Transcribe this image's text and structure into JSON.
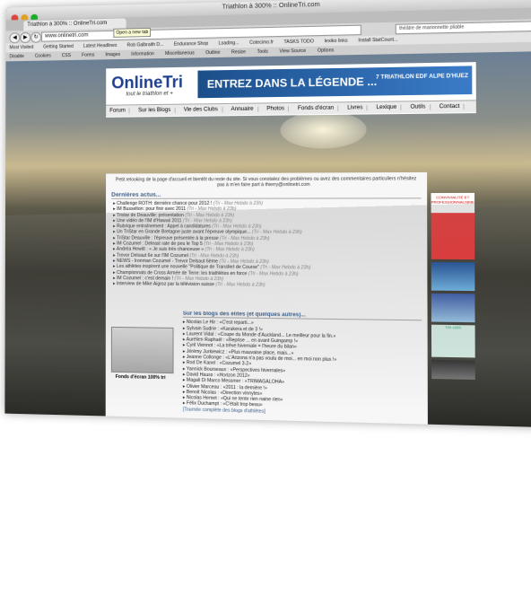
{
  "window": {
    "title": "Triathlon à 300% :: OnlineTri.com"
  },
  "tab": {
    "label": "Triathlon à 300% :: OnlineTri.com",
    "tooltip": "Open a new tab"
  },
  "navbar": {
    "url": "www.onlinetri.com",
    "search": "théâtre de marionnette pliable"
  },
  "bookmarks": [
    "Most Visited",
    "Getting Started",
    "Latest Headlines",
    "Rob Galbraith D...",
    "Endurance Shop",
    "Loading...",
    "Cotecimo.fr",
    "TASKS TODO",
    "lexiko links",
    "Install StatCount..."
  ],
  "toolbar": [
    "Disable",
    "Cookies",
    "CSS",
    "Forms",
    "Images",
    "Information",
    "Miscellaneous",
    "Outline",
    "Resize",
    "Tools",
    "View Source",
    "Options"
  ],
  "site": {
    "logo": "OnlineTri",
    "logo_sub": "tout le triathlon et +",
    "banner": "ENTREZ DANS LA LÉGENDE ...",
    "banner_sub": "7 TRIATHLON EDF ALPE D'HUEZ",
    "nav": [
      "Forum",
      "Sur les Blogs",
      "Vie des Clubs",
      "Annuaire",
      "Photos",
      "Fonds d'écran",
      "Livres",
      "Lexique",
      "Outils",
      "Contact"
    ]
  },
  "notice": "Petit relooking de la page d'accueil et bientôt du reste du site. Si vous constatez des problèmes ou avez des commentaires particuliers n'hésitez pas à m'en faire part à thierry@onlinetri.com",
  "news": {
    "title": "Dernières actus...",
    "items": [
      "Challenge ROTH: dernière chance pour 2012 !",
      "IM Busselton: pour finir avec 2011",
      "Tristar de Deauville: présentation",
      "Une vidéo de l'IM d'Hawaii 2011",
      "Rubrique entraînement : Appel à candidatures",
      "Un TriStar en Grande Bretagne juste avant l'épreuve olympique...",
      "TriStar Deauville : l'épreuve présentée à la presse",
      "IM Cozumel : Deleast rate de peu le Top 5",
      "Andréa Hewitt : « Je suis très chanceuse »",
      "Trevor Delsaut 6e sur l'IM Cozumel",
      "NEWS - Ironman Cozumel - Trevor Delsaut 6ème",
      "Les athlètes inspirent une nouvelle \"Politique de Transfert de Course\"",
      "Championnats de Cross Armée de Terre: les triathlètes en force",
      "IM Cozumel : c'est demain !",
      "Interview de Mike Aigroz par la télévision suisse"
    ],
    "meta": "(Tri - Max Hebdo à 23h)"
  },
  "blogs": {
    "title": "Sur les blogs des élites (et quelques autres)...",
    "items": [
      "Nicolas Le Hir : «C'est reparti...»",
      "Sylvain Sudrie : «Karukera et de 3 !»",
      "Laurent Vidal : «Coupe du Monde d'Auckland... Le meilleur pour la fin.»",
      "Aurélien Raphaël : «Reprise ... en avant Guingamp !»",
      "Cyril Viennot : «La trêve hivernale = l'heure du bilan»",
      "Jérémy Jurkiewicz : «Plus mauvaise place, mais...»",
      "Jeanne Collonge : «L'Arizona n'a pas voulu de moi... en moi non plus !»",
      "Rod De Kanel : «Cozumel 3-2»",
      "Yannick Bourseaux : «Perspectives hivernales»",
      "David Hauss : «Horizon 2012»",
      "Magali Di Marco Messmer : «TRIMAGALOHA»",
      "Olivier Marceau : «2011 : la dernière !»",
      "Benoit Nicolas : «Direction vinnyles»",
      "Nicolas Hemet : «Qui ne tente rien naine rien»",
      "Félix Duchampt : «C'était trop beau»"
    ],
    "more": "[Tournée complète des blogs d'athlètes]"
  },
  "photo_caption": "Fonds d'écran 100% tri",
  "sidebar": {
    "ad1": "CONVIVIALITÉ ET PROFESSIONNALISME",
    "ad4": "TRI-OBS"
  }
}
